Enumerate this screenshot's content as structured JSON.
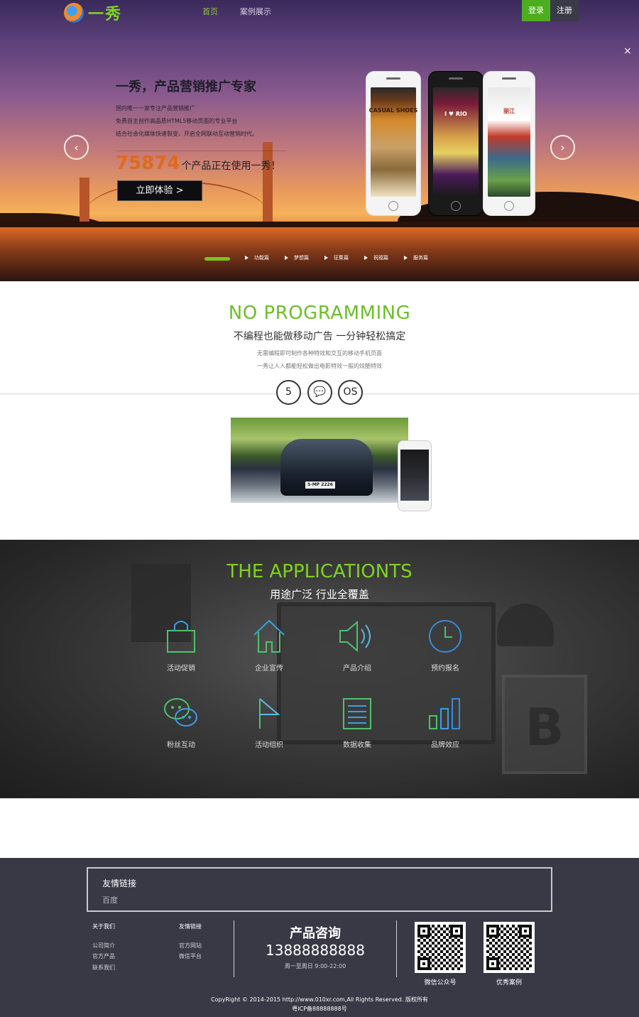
{
  "nav": {
    "brand": "一秀",
    "links": [
      "首页",
      "案例展示"
    ],
    "login": "登录",
    "register": "注册",
    "close": "×"
  },
  "hero": {
    "title": "一秀，产品营销推广专家",
    "lines": [
      "国内唯一一家专注产品营销推广",
      "免费自主创作高品质HTML5移动页面的专业平台",
      "结合社会化媒体快速裂变，开启全网联动互动营销时代。"
    ],
    "count": "75874",
    "count_tail": "个产品正在使用一秀！",
    "cta": "立即体验 >",
    "prev": "‹",
    "next": "›",
    "phones": [
      "CASUAL SHOES",
      "I ♥ RIO",
      "丽江"
    ],
    "tabs": [
      "功能篇",
      "梦想篇",
      "征集篇",
      "祝福篇",
      "服务篇"
    ]
  },
  "noprog": {
    "title": "NO PROGRAMMING",
    "subtitle": "不编程也能做移动广告  一分钟轻松搞定",
    "lines": [
      "无需编程即可制作各种特效和交互的移动手机页面",
      "一秀让人人都能轻松做出电影特效一般的炫酷特效"
    ],
    "badges": [
      {
        "icon": "html5-icon",
        "glyph": "5"
      },
      {
        "icon": "wechat-icon",
        "glyph": "💬"
      },
      {
        "icon": "ios-icon",
        "glyph": "OS"
      }
    ],
    "plate": "S·MP 2226"
  },
  "apps": {
    "title": "THE APPLICATIONTS",
    "subtitle": "用途广泛  行业全覆盖",
    "items": [
      {
        "label": "活动促销",
        "icon": "shopping-bag-icon",
        "color": "#4cc36a"
      },
      {
        "label": "企业宣传",
        "icon": "home-icon",
        "color": "#3aa0e6"
      },
      {
        "label": "产品介绍",
        "icon": "speaker-icon",
        "color": "#5ab8e8"
      },
      {
        "label": "预约报名",
        "icon": "clock-icon",
        "color": "#3a8ad6"
      },
      {
        "label": "粉丝互动",
        "icon": "chat-icon",
        "color": "#4cc36a"
      },
      {
        "label": "活动组织",
        "icon": "flag-icon",
        "color": "#5ab8e8"
      },
      {
        "label": "数据收集",
        "icon": "list-icon",
        "color": "#4cc36a"
      },
      {
        "label": "品牌效应",
        "icon": "bar-chart-icon",
        "color": "#3a8ad6"
      }
    ]
  },
  "footer": {
    "links_title": "友情链接",
    "links": [
      "百度"
    ],
    "col1": {
      "title": "关于我们",
      "items": [
        "公司简介",
        "官方产品",
        "联系我们"
      ]
    },
    "col2": {
      "title": "友情链接",
      "items": [
        "官方网站",
        "微信平台"
      ]
    },
    "consult_title": "产品咨询",
    "phone": "13888888888",
    "hours": "周一至周日 9:00-22:00",
    "qr1": "微信公众号",
    "qr2": "优秀案例",
    "copyright": "CopyRight © 2014-2015 http://www.010xr.com,All Rights Reserved.  版权所有",
    "icp": "粤ICP备88888888号"
  }
}
